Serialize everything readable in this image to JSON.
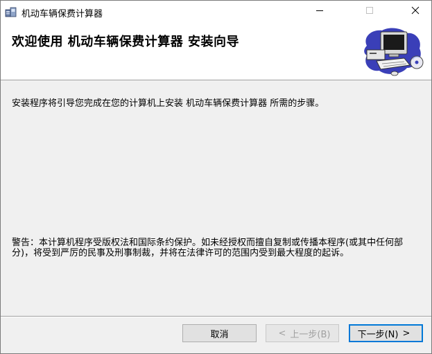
{
  "window": {
    "title": "机动车辆保费计算器",
    "icons": [
      "installer-icon",
      "minimize-icon",
      "maximize-icon",
      "close-icon"
    ]
  },
  "banner": {
    "title": "欢迎使用 机动车辆保费计算器 安装向导",
    "art_icon": "computer-install-illustration"
  },
  "content": {
    "intro": "安装程序将引导您完成在您的计算机上安装 机动车辆保费计算器 所需的步骤。",
    "warning": "警告：本计算机程序受版权法和国际条约保护。如未经授权而擅自复制或传播本程序(或其中任何部分)，将受到严厉的民事及刑事制裁，并将在法律许可的范围内受到最大程度的起诉。"
  },
  "buttons": {
    "cancel": "取消",
    "back": "上一步(B)",
    "back_chevron": "<",
    "next": "下一步(N)",
    "next_chevron": ">",
    "back_enabled": false
  },
  "colors": {
    "background": "#f0f0f0",
    "banner_bg": "#ffffff",
    "focus_border": "#0078d7",
    "disabled_text": "#a0a0a0"
  }
}
